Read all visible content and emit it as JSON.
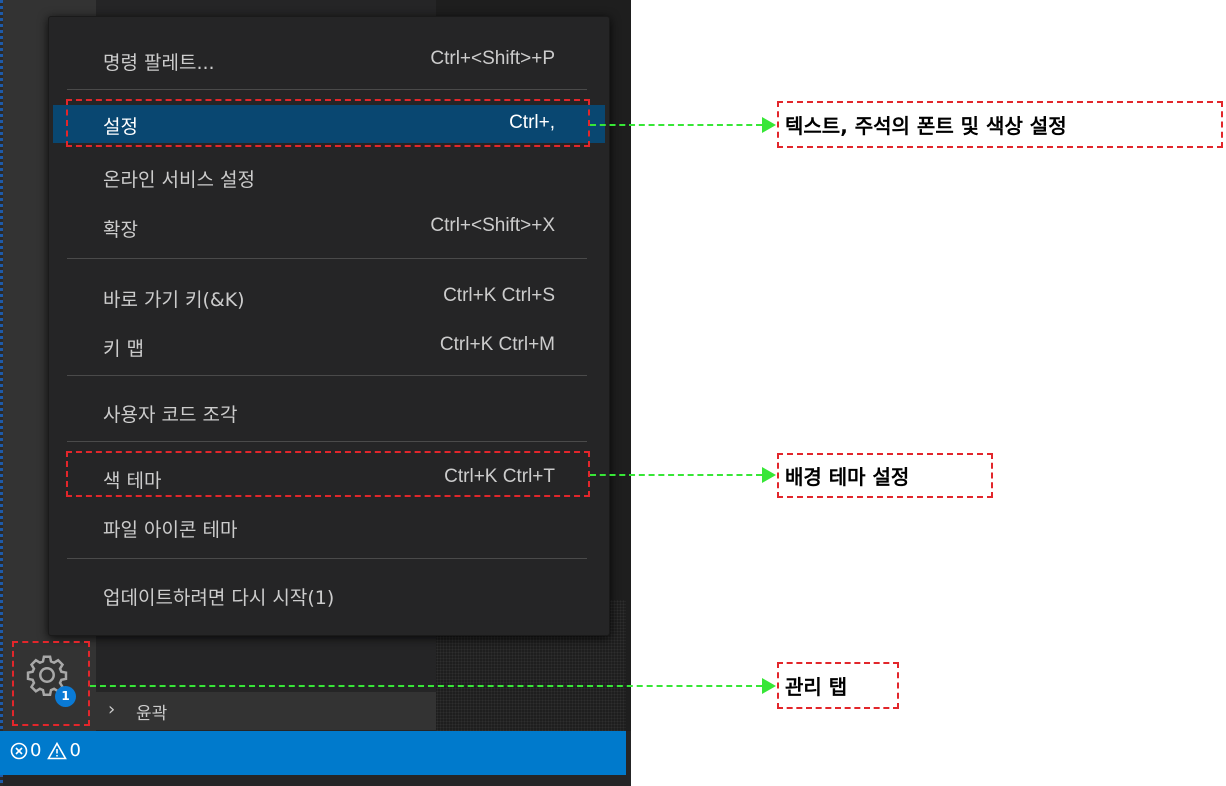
{
  "menu": {
    "items": [
      {
        "label": "명령 팔레트...",
        "shortcut": "Ctrl+<Shift>+P"
      },
      {
        "label": "설정",
        "shortcut": "Ctrl+,"
      },
      {
        "label": "온라인 서비스 설정",
        "shortcut": ""
      },
      {
        "label": "확장",
        "shortcut": "Ctrl+<Shift>+X"
      },
      {
        "label": "바로 가기 키(&K)",
        "shortcut": "Ctrl+K Ctrl+S"
      },
      {
        "label": "키 맵",
        "shortcut": "Ctrl+K Ctrl+M"
      },
      {
        "label": "사용자 코드 조각",
        "shortcut": ""
      },
      {
        "label": "색 테마",
        "shortcut": "Ctrl+K Ctrl+T"
      },
      {
        "label": "파일 아이콘 테마",
        "shortcut": ""
      },
      {
        "label": "업데이트하려면 다시 시작(1)",
        "shortcut": ""
      }
    ],
    "active_item": "설정"
  },
  "sidebar": {
    "outline_label": "윤곽"
  },
  "activity_bar": {
    "manage_icon": "gear-icon",
    "badge": "1"
  },
  "status_bar": {
    "errors": "0",
    "warnings": "0",
    "error_icon": "circle-x-icon",
    "warning_icon": "warning-triangle-icon"
  },
  "annotations": {
    "settings_note": "텍스트, 주석의 폰트 및 색상 설정",
    "theme_note": "배경 테마 설정",
    "manage_note": "관리 탭"
  },
  "colors": {
    "menu_bg": "#252526",
    "highlight": "#094771",
    "statusbar": "#007acc",
    "annotation_box": "#e2262b",
    "arrow": "#37e637"
  }
}
